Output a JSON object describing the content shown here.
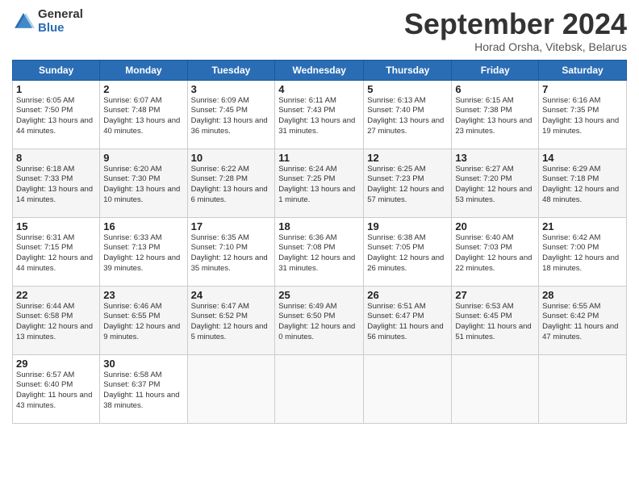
{
  "header": {
    "logo_general": "General",
    "logo_blue": "Blue",
    "month_title": "September 2024",
    "subtitle": "Horad Orsha, Vitebsk, Belarus"
  },
  "weekdays": [
    "Sunday",
    "Monday",
    "Tuesday",
    "Wednesday",
    "Thursday",
    "Friday",
    "Saturday"
  ],
  "weeks": [
    [
      {
        "day": "1",
        "sunrise": "6:05 AM",
        "sunset": "7:50 PM",
        "daylight": "13 hours and 44 minutes."
      },
      {
        "day": "2",
        "sunrise": "6:07 AM",
        "sunset": "7:48 PM",
        "daylight": "13 hours and 40 minutes."
      },
      {
        "day": "3",
        "sunrise": "6:09 AM",
        "sunset": "7:45 PM",
        "daylight": "13 hours and 36 minutes."
      },
      {
        "day": "4",
        "sunrise": "6:11 AM",
        "sunset": "7:43 PM",
        "daylight": "13 hours and 31 minutes."
      },
      {
        "day": "5",
        "sunrise": "6:13 AM",
        "sunset": "7:40 PM",
        "daylight": "13 hours and 27 minutes."
      },
      {
        "day": "6",
        "sunrise": "6:15 AM",
        "sunset": "7:38 PM",
        "daylight": "13 hours and 23 minutes."
      },
      {
        "day": "7",
        "sunrise": "6:16 AM",
        "sunset": "7:35 PM",
        "daylight": "13 hours and 19 minutes."
      }
    ],
    [
      {
        "day": "8",
        "sunrise": "6:18 AM",
        "sunset": "7:33 PM",
        "daylight": "13 hours and 14 minutes."
      },
      {
        "day": "9",
        "sunrise": "6:20 AM",
        "sunset": "7:30 PM",
        "daylight": "13 hours and 10 minutes."
      },
      {
        "day": "10",
        "sunrise": "6:22 AM",
        "sunset": "7:28 PM",
        "daylight": "13 hours and 6 minutes."
      },
      {
        "day": "11",
        "sunrise": "6:24 AM",
        "sunset": "7:25 PM",
        "daylight": "13 hours and 1 minute."
      },
      {
        "day": "12",
        "sunrise": "6:25 AM",
        "sunset": "7:23 PM",
        "daylight": "12 hours and 57 minutes."
      },
      {
        "day": "13",
        "sunrise": "6:27 AM",
        "sunset": "7:20 PM",
        "daylight": "12 hours and 53 minutes."
      },
      {
        "day": "14",
        "sunrise": "6:29 AM",
        "sunset": "7:18 PM",
        "daylight": "12 hours and 48 minutes."
      }
    ],
    [
      {
        "day": "15",
        "sunrise": "6:31 AM",
        "sunset": "7:15 PM",
        "daylight": "12 hours and 44 minutes."
      },
      {
        "day": "16",
        "sunrise": "6:33 AM",
        "sunset": "7:13 PM",
        "daylight": "12 hours and 39 minutes."
      },
      {
        "day": "17",
        "sunrise": "6:35 AM",
        "sunset": "7:10 PM",
        "daylight": "12 hours and 35 minutes."
      },
      {
        "day": "18",
        "sunrise": "6:36 AM",
        "sunset": "7:08 PM",
        "daylight": "12 hours and 31 minutes."
      },
      {
        "day": "19",
        "sunrise": "6:38 AM",
        "sunset": "7:05 PM",
        "daylight": "12 hours and 26 minutes."
      },
      {
        "day": "20",
        "sunrise": "6:40 AM",
        "sunset": "7:03 PM",
        "daylight": "12 hours and 22 minutes."
      },
      {
        "day": "21",
        "sunrise": "6:42 AM",
        "sunset": "7:00 PM",
        "daylight": "12 hours and 18 minutes."
      }
    ],
    [
      {
        "day": "22",
        "sunrise": "6:44 AM",
        "sunset": "6:58 PM",
        "daylight": "12 hours and 13 minutes."
      },
      {
        "day": "23",
        "sunrise": "6:46 AM",
        "sunset": "6:55 PM",
        "daylight": "12 hours and 9 minutes."
      },
      {
        "day": "24",
        "sunrise": "6:47 AM",
        "sunset": "6:52 PM",
        "daylight": "12 hours and 5 minutes."
      },
      {
        "day": "25",
        "sunrise": "6:49 AM",
        "sunset": "6:50 PM",
        "daylight": "12 hours and 0 minutes."
      },
      {
        "day": "26",
        "sunrise": "6:51 AM",
        "sunset": "6:47 PM",
        "daylight": "11 hours and 56 minutes."
      },
      {
        "day": "27",
        "sunrise": "6:53 AM",
        "sunset": "6:45 PM",
        "daylight": "11 hours and 51 minutes."
      },
      {
        "day": "28",
        "sunrise": "6:55 AM",
        "sunset": "6:42 PM",
        "daylight": "11 hours and 47 minutes."
      }
    ],
    [
      {
        "day": "29",
        "sunrise": "6:57 AM",
        "sunset": "6:40 PM",
        "daylight": "11 hours and 43 minutes."
      },
      {
        "day": "30",
        "sunrise": "6:58 AM",
        "sunset": "6:37 PM",
        "daylight": "11 hours and 38 minutes."
      },
      null,
      null,
      null,
      null,
      null
    ]
  ]
}
